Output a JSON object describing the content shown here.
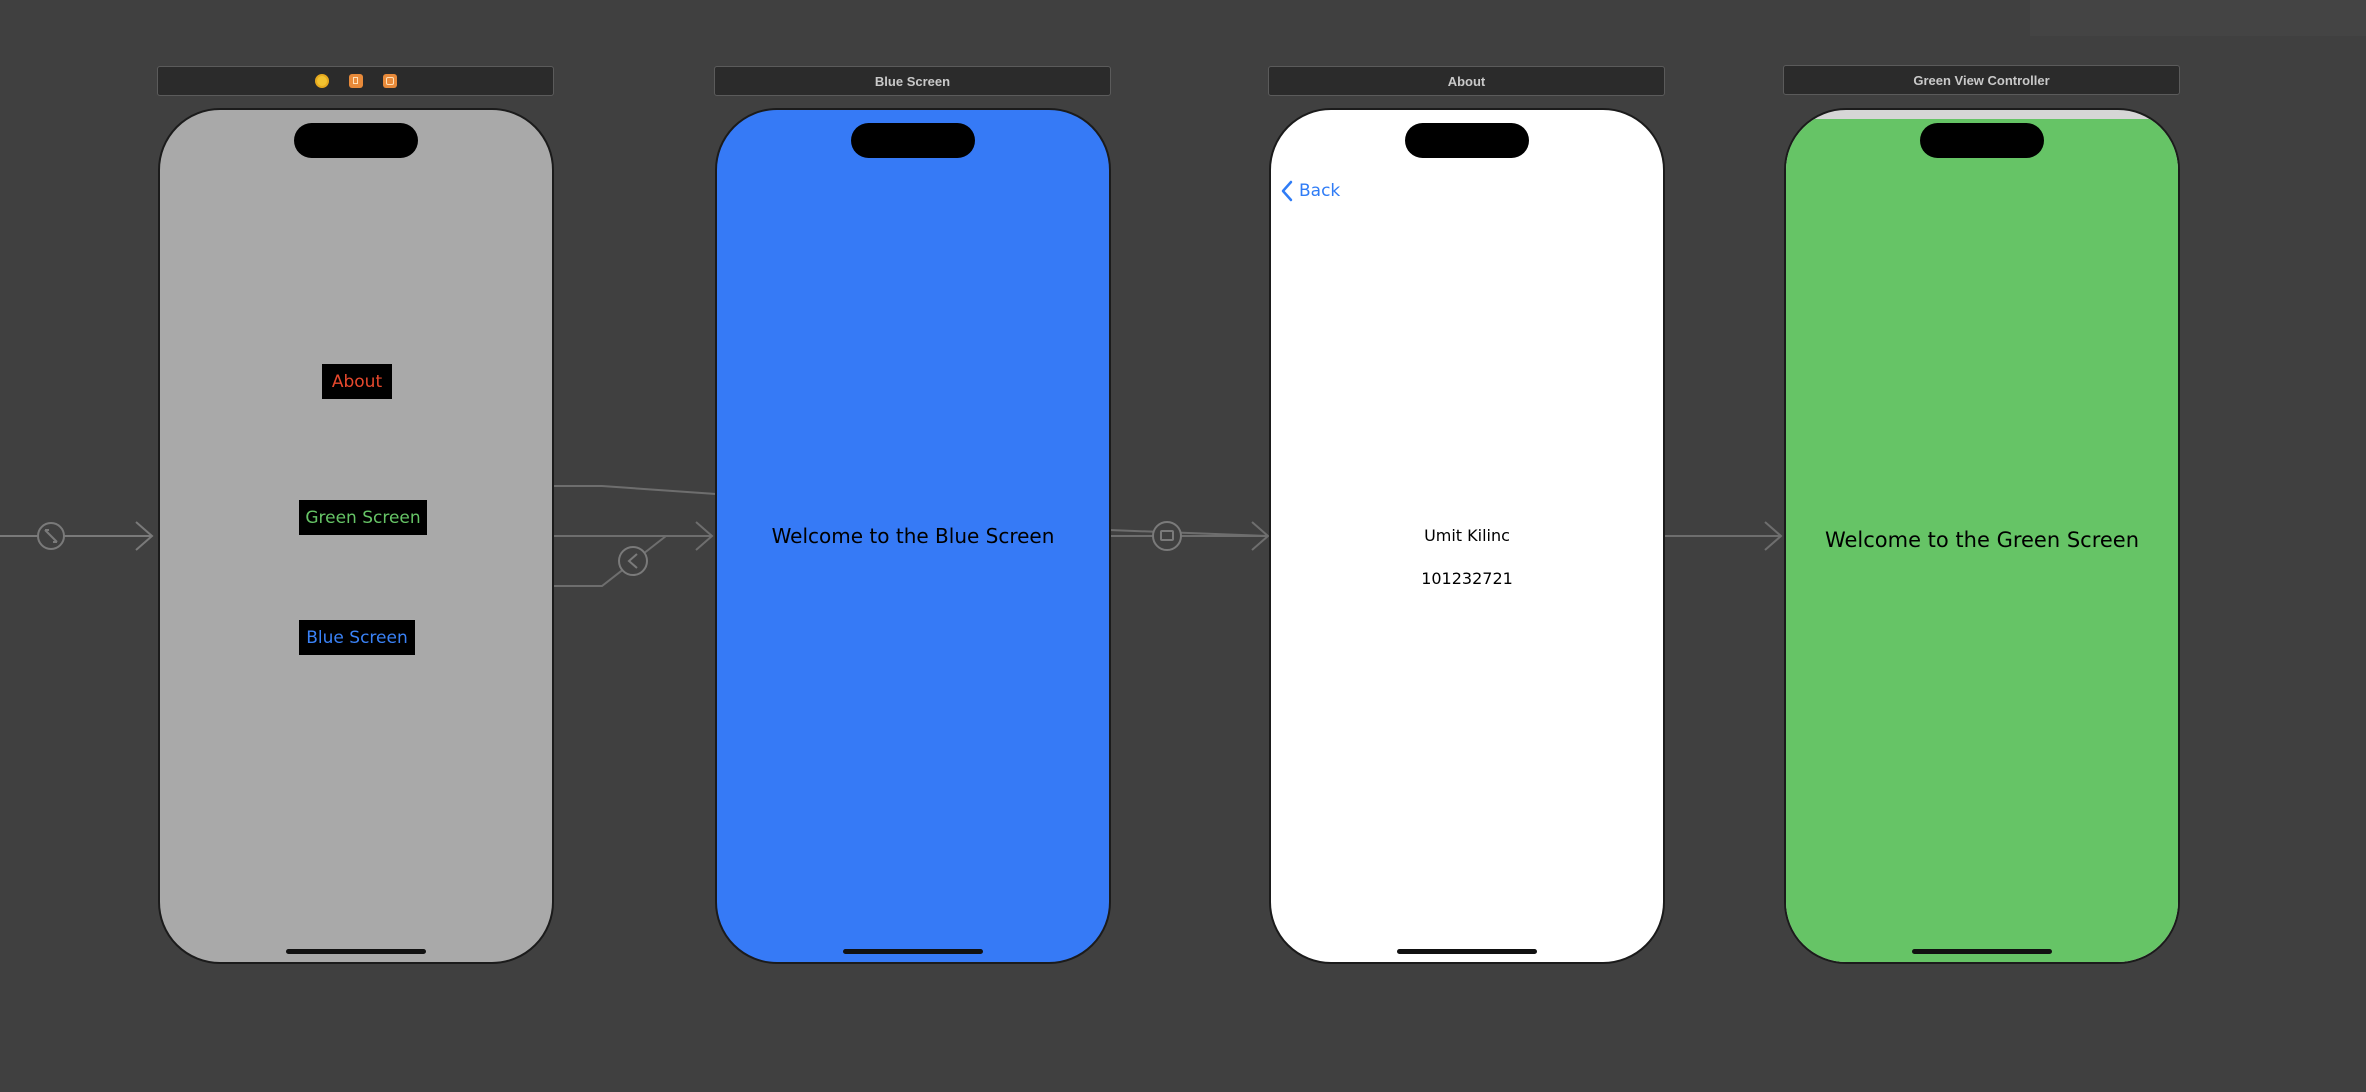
{
  "colors": {
    "canvas": "#404040",
    "initial_screen_bg": "#a9a9a9",
    "blue_screen_bg": "#367af6",
    "about_screen_bg": "#ffffff",
    "green_screen_bg": "#66c466",
    "about_button_text": "#e8492d",
    "green_button_text": "#66c466",
    "blue_button_text": "#3a82f7",
    "back_link": "#2f7cf6"
  },
  "scenes": {
    "initial": {
      "header_icons": [
        "view-controller-icon",
        "first-responder-icon",
        "exit-icon"
      ],
      "buttons": {
        "about": "About",
        "green": "Green Screen",
        "blue": "Blue Screen"
      }
    },
    "blue": {
      "title": "Blue Screen",
      "label": "Welcome to the Blue Screen"
    },
    "about": {
      "title": "About",
      "back_label": "Back",
      "name": "Umit Kilinc",
      "student_id": "101232721"
    },
    "green": {
      "title": "Green View Controller",
      "label": "Welcome to the Green Screen"
    }
  },
  "segue_icons": [
    "entry-point-icon",
    "back-segue-icon",
    "modal-segue-icon"
  ]
}
